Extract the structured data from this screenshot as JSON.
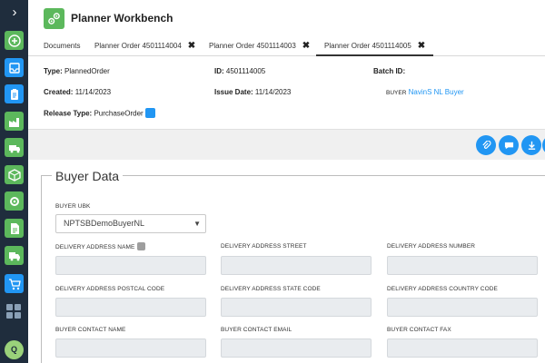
{
  "header": {
    "title": "Planner Workbench"
  },
  "tabs": [
    {
      "label": "Documents",
      "closable": false
    },
    {
      "label": "Planner Order 4501114004",
      "closable": true
    },
    {
      "label": "Planner Order 4501114003",
      "closable": true
    },
    {
      "label": "Planner Order 4501114005",
      "closable": true,
      "active": true
    }
  ],
  "tab_close_glyph": "✖",
  "info": {
    "type_label": "Type:",
    "type_value": "PlannedOrder",
    "id_label": "ID:",
    "id_value": "4501114005",
    "batch_label": "Batch ID:",
    "batch_value": "",
    "created_label": "Created:",
    "created_value": "11/14/2023",
    "issue_label": "Issue Date:",
    "issue_value": "11/14/2023",
    "buyer_label": "BUYER",
    "buyer_value": "NavinS NL Buyer",
    "release_label": "Release Type:",
    "release_value": "PurchaseOrder"
  },
  "form": {
    "legend": "Buyer Data",
    "buyer_ubk_label": "BUYER UBK",
    "buyer_ubk_value": "NPTSBDemoBuyerNL",
    "labels": {
      "delivery_address_name": "DELIVERY ADDRESS NAME",
      "delivery_address_street": "DELIVERY ADDRESS STREET",
      "delivery_address_number": "DELIVERY ADDRESS NUMBER",
      "delivery_address_postcal_code": "DELIVERY ADDRESS POSTCAL CODE",
      "delivery_address_state_code": "DELIVERY ADDRESS STATE CODE",
      "delivery_address_country_code": "DELIVERY ADDRESS COUNTRY CODE",
      "buyer_contact_name": "BUYER CONTACT NAME",
      "buyer_contact_email": "BUYER CONTACT EMAIL",
      "buyer_contact_fax": "BUYER CONTACT FAX"
    }
  },
  "sidebar": {
    "toggle_glyph": "›",
    "avatar_initial": "Q",
    "icons": [
      "plus-icon",
      "inbox-icon",
      "clipboard-icon",
      "factory-icon",
      "truck-icon",
      "box-icon",
      "settings-icon",
      "document-icon",
      "delivery-icon",
      "cart-icon",
      "apps-grid-icon"
    ]
  },
  "actions": {
    "icons": [
      "paperclip-icon",
      "chat-icon",
      "download-icon"
    ]
  },
  "colors": {
    "sidebar": "#1f2d3d",
    "green": "#5cb85c",
    "blue": "#2196f3"
  }
}
